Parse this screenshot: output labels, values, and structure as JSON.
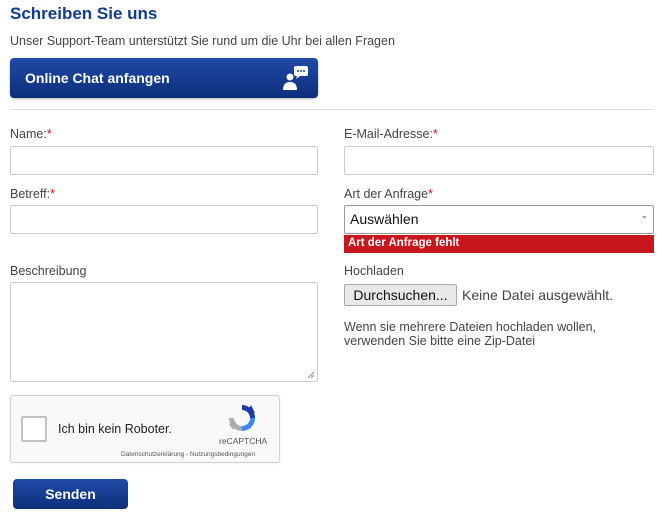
{
  "header": {
    "title": "Schreiben Sie uns",
    "subtitle": "Unser Support-Team unterstützt Sie rund um die Uhr bei allen Fragen"
  },
  "chat": {
    "button_label": "Online Chat anfangen",
    "icon": "chat-person-icon"
  },
  "form": {
    "name_label": "Name:",
    "email_label": "E-Mail-Adresse:",
    "subject_label": "Betreff:",
    "type_label": "Art der Anfrage",
    "type_selected": "Auswählen",
    "type_error": "Art der Anfrage fehlt",
    "description_label": "Beschreibung",
    "upload_label": "Hochladen",
    "upload_button": "Durchsuchen...",
    "upload_status": "Keine Datei ausgewählt.",
    "upload_hint": "Wenn sie mehrere Dateien hochladen wollen, verwenden Sie bitte eine Zip-Datei",
    "required_marker": "*"
  },
  "captcha": {
    "label": "Ich bin kein Roboter.",
    "brand": "reCAPTCHA",
    "links": "Datenschutzerklärung - Nutzungsbedingungen"
  },
  "submit": {
    "label": "Senden"
  },
  "colors": {
    "brand_blue": "#123c8c",
    "error_red": "#c8161d"
  }
}
